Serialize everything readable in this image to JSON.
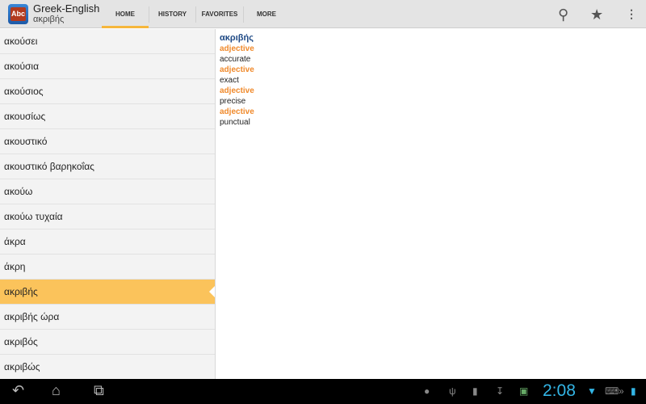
{
  "app": {
    "title": "Greek-English",
    "subtitle": "ακριβής",
    "logo_text": "Abc"
  },
  "tabs": [
    {
      "label": "HOME"
    },
    {
      "label": "HISTORY"
    },
    {
      "label": "FAVORITES"
    },
    {
      "label": "MORE"
    }
  ],
  "list": [
    "ακούσει",
    "ακούσια",
    "ακούσιος",
    "ακουσίως",
    "ακουστικό",
    "ακουστικό βαρηκοΐας",
    "ακούω",
    "ακούω τυχαία",
    "άκρα",
    "άκρη",
    "ακριβής",
    "ακριβής ώρα",
    "ακριβός",
    "ακριβώς"
  ],
  "selected_index": 10,
  "entry": {
    "headword": "ακριβής",
    "senses": [
      {
        "pos": "adjective",
        "tr": "accurate"
      },
      {
        "pos": "adjective",
        "tr": "exact"
      },
      {
        "pos": "adjective",
        "tr": "precise"
      },
      {
        "pos": "adjective",
        "tr": "punctual"
      }
    ]
  },
  "status": {
    "time": "2:08"
  }
}
